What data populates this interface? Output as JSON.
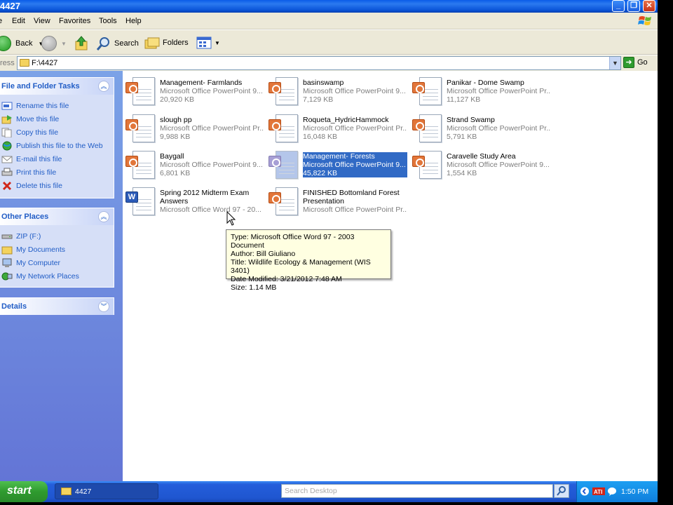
{
  "window": {
    "title": "4427"
  },
  "menu": [
    "Edit",
    "View",
    "Favorites",
    "Tools",
    "Help"
  ],
  "toolbar": {
    "back": "Back",
    "search": "Search",
    "folders": "Folders"
  },
  "address": {
    "label": "ress",
    "path": "F:\\4427",
    "go": "Go"
  },
  "panels": {
    "file_tasks": {
      "title": "File and Folder Tasks",
      "items": [
        {
          "label": "Rename this file",
          "icon": "rename-icon"
        },
        {
          "label": "Move this file",
          "icon": "move-icon"
        },
        {
          "label": "Copy this file",
          "icon": "copy-icon"
        },
        {
          "label": "Publish this file to the Web",
          "icon": "globe-icon"
        },
        {
          "label": "E-mail this file",
          "icon": "email-icon"
        },
        {
          "label": "Print this file",
          "icon": "print-icon"
        },
        {
          "label": "Delete this file",
          "icon": "delete-icon"
        }
      ]
    },
    "other_places": {
      "title": "Other Places",
      "items": [
        {
          "label": "ZIP (F:)",
          "icon": "drive-icon"
        },
        {
          "label": "My Documents",
          "icon": "folder-icon"
        },
        {
          "label": "My Computer",
          "icon": "computer-icon"
        },
        {
          "label": "My Network Places",
          "icon": "network-icon"
        }
      ]
    },
    "details": {
      "title": "Details"
    }
  },
  "files": [
    {
      "name": "Management- Farmlands",
      "type": "Microsoft Office PowerPoint 9...",
      "size": "20,920 KB",
      "kind": "ppt"
    },
    {
      "name": "basinswamp",
      "type": "Microsoft Office PowerPoint 9...",
      "size": "7,129 KB",
      "kind": "ppt"
    },
    {
      "name": "Panikar - Dome Swamp",
      "type": "Microsoft Office PowerPoint Pr...",
      "size": "11,127 KB",
      "kind": "ppt"
    },
    {
      "name": "slough pp",
      "type": "Microsoft Office PowerPoint Pr...",
      "size": "9,988 KB",
      "kind": "ppt"
    },
    {
      "name": "Roqueta_HydricHammock",
      "type": "Microsoft Office PowerPoint Pr...",
      "size": "16,048 KB",
      "kind": "ppt"
    },
    {
      "name": "Strand Swamp",
      "type": "Microsoft Office PowerPoint Pr...",
      "size": "5,791 KB",
      "kind": "ppt"
    },
    {
      "name": "Baygall",
      "type": "Microsoft Office PowerPoint 9...",
      "size": "6,801 KB",
      "kind": "ppt"
    },
    {
      "name": "Management- Forests",
      "type": "Microsoft Office PowerPoint 9...",
      "size": "45,822 KB",
      "kind": "ppt",
      "selected": true
    },
    {
      "name": "Caravelle Study Area",
      "type": "Microsoft Office PowerPoint 9...",
      "size": "1,554 KB",
      "kind": "ppt"
    },
    {
      "name": "Spring 2012 Midterm Exam Answers",
      "type": "Microsoft Office Word 97 - 20...",
      "size": "",
      "kind": "word"
    },
    {
      "name": "FINISHED Bottomland Forest Presentation",
      "type": "Microsoft Office PowerPoint Pr...",
      "size": "",
      "kind": "ppt"
    }
  ],
  "tooltip": {
    "lines": [
      "Type: Microsoft Office Word 97 - 2003 Document",
      "Author: Bill Giuliano",
      "Title: Wildlife Ecology & Management (WIS 3401)",
      "Date Modified: 3/21/2012 7:48 AM",
      "Size: 1.14 MB"
    ]
  },
  "taskbar": {
    "start": "start",
    "window_button": "4427",
    "search_placeholder": "Search Desktop",
    "clock": "1:50 PM"
  }
}
